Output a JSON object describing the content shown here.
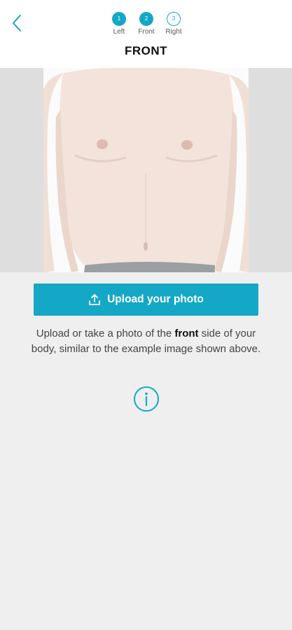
{
  "header": {
    "title": "FRONT",
    "steps": [
      {
        "number": "1",
        "label": "Left",
        "state": "done"
      },
      {
        "number": "2",
        "label": "Front",
        "state": "current"
      },
      {
        "number": "3",
        "label": "Right",
        "state": "todo"
      }
    ]
  },
  "example_image": {
    "description_icon": "front-body-example-image"
  },
  "upload": {
    "label": "Upload your photo",
    "icon": "upload-icon"
  },
  "instructions": {
    "before": "Upload or take a photo of the ",
    "bold": "front",
    "after": " side of your body, similar to the example image shown above."
  },
  "colors": {
    "accent": "#14a8c6",
    "background": "#efefef",
    "header": "#ffffff"
  }
}
